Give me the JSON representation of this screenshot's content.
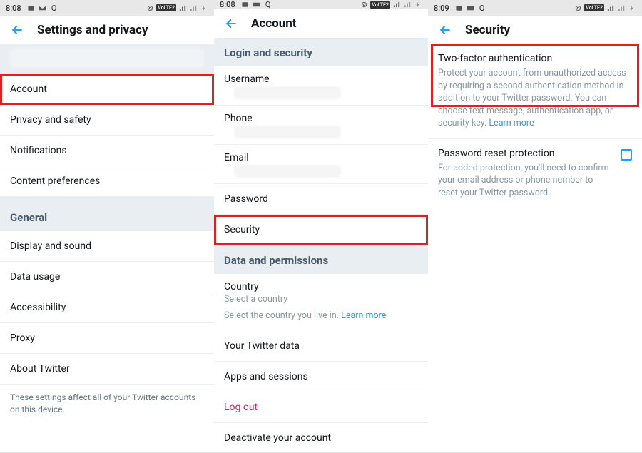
{
  "status": {
    "time1": "8:08",
    "time2": "8:08",
    "time3": "8:09",
    "volte": "VoLTE2"
  },
  "panel1": {
    "title": "Settings and privacy",
    "items": [
      "Account",
      "Privacy and safety",
      "Notifications",
      "Content preferences"
    ],
    "general_header": "General",
    "general_items": [
      "Display and sound",
      "Data usage",
      "Accessibility",
      "Proxy",
      "About Twitter"
    ],
    "footer": "These settings affect all of your Twitter accounts on this device."
  },
  "panel2": {
    "title": "Account",
    "section1": "Login and security",
    "items1": [
      "Username",
      "Phone",
      "Email",
      "Password",
      "Security"
    ],
    "section2": "Data and permissions",
    "country_label": "Country",
    "country_sub": "Select a country",
    "country_note": "Select the country you live in. ",
    "learn_more": "Learn more",
    "items2": [
      "Your Twitter data",
      "Apps and sessions"
    ],
    "logout": "Log out",
    "deactivate": "Deactivate your account"
  },
  "panel3": {
    "title": "Security",
    "tfa_title": "Two-factor authentication",
    "tfa_desc": "Protect your account from unauthorized access by requiring a second authentication method in addition to your Twitter password. You can choose text message, authentication app, or security key. ",
    "learn_more": "Learn more",
    "prp_title": "Password reset protection",
    "prp_desc": "For added protection, you'll need to confirm your email address or phone number to reset your Twitter password."
  }
}
